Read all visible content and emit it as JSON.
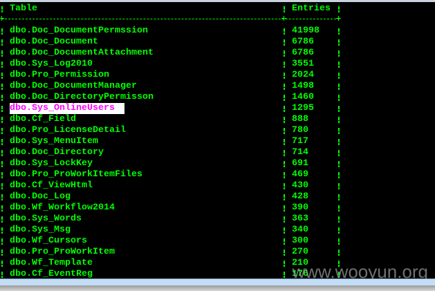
{
  "table": {
    "headers": {
      "name": "Table",
      "entries": "Entries"
    },
    "highlighted_row": 7,
    "rows": [
      {
        "name": "dbo.Doc_DocumentPermssion",
        "entries": "41998"
      },
      {
        "name": "dbo.Doc_Document",
        "entries": "6786"
      },
      {
        "name": "dbo.Doc_DocumentAttachment",
        "entries": "6786"
      },
      {
        "name": "dbo.Sys_Log2010",
        "entries": "3551"
      },
      {
        "name": "dbo.Pro_Permission",
        "entries": "2024"
      },
      {
        "name": "dbo.Doc_DocumentManager",
        "entries": "1498"
      },
      {
        "name": "dbo.Doc_DirectoryPermisson",
        "entries": "1460"
      },
      {
        "name": "dbo.Sys_OnlineUsers",
        "entries": "1295"
      },
      {
        "name": "dbo.Cf_Field",
        "entries": "888"
      },
      {
        "name": "dbo.Pro_LicenseDetail",
        "entries": "780"
      },
      {
        "name": "dbo.Sys_MenuItem",
        "entries": "717"
      },
      {
        "name": "dbo.Doc_Directory",
        "entries": "714"
      },
      {
        "name": "dbo.Sys_LockKey",
        "entries": "691"
      },
      {
        "name": "dbo.Pro_ProWorkItemFiles",
        "entries": "469"
      },
      {
        "name": "dbo.Cf_ViewHtml",
        "entries": "430"
      },
      {
        "name": "dbo.Doc_Log",
        "entries": "428"
      },
      {
        "name": "dbo.Wf_Workflow2014",
        "entries": "390"
      },
      {
        "name": "dbo.Sys_Words",
        "entries": "363"
      },
      {
        "name": "dbo.Sys_Msg",
        "entries": "340"
      },
      {
        "name": "dbo.Wf_Cursors",
        "entries": "300"
      },
      {
        "name": "dbo.Pro_ProWorkItem",
        "entries": "270"
      },
      {
        "name": "dbo.Wf_Template",
        "entries": "210"
      },
      {
        "name": "dbo.Cf_EventReg",
        "entries": "176"
      }
    ]
  },
  "watermark": "www.wooyun.org",
  "colors": {
    "text": "#00ff00",
    "highlight_text": "#ff00ff",
    "highlight_bg": "#ffffff",
    "background": "#000000"
  }
}
